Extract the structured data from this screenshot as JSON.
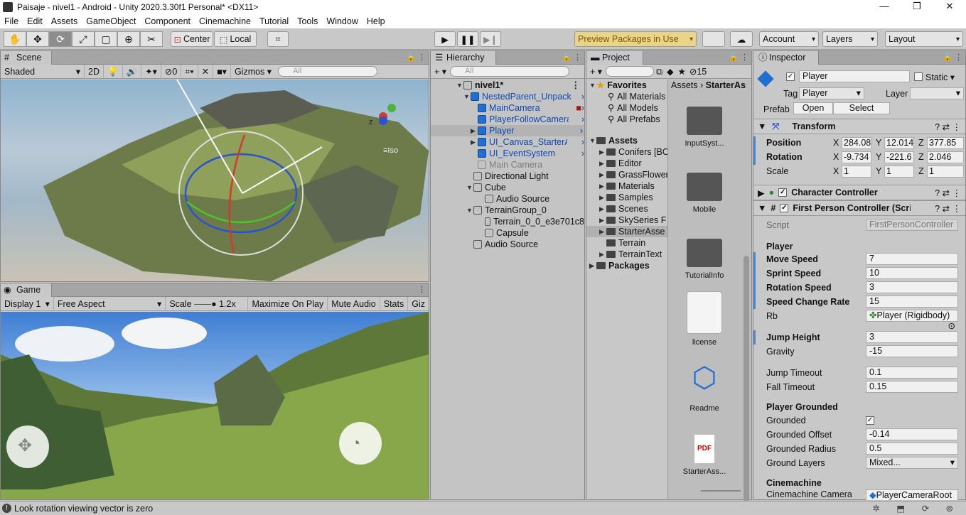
{
  "window": {
    "title": "Paisaje - nivel1 - Android - Unity 2020.3.30f1 Personal* <DX11>",
    "minimize": "—",
    "maximize": "❐",
    "close": "✕"
  },
  "menu": [
    "File",
    "Edit",
    "Assets",
    "GameObject",
    "Component",
    "Cinemachine",
    "Tutorial",
    "Tools",
    "Window",
    "Help"
  ],
  "toolbar": {
    "center": "Center",
    "local": "Local",
    "preview": "Preview Packages in Use",
    "account": "Account",
    "layers": "Layers",
    "layout": "Layout"
  },
  "scene": {
    "tab": "Scene",
    "shading": "Shaded",
    "mode2d": "2D",
    "hidden_count": "0",
    "gizmos": "Gizmos",
    "search_placeholder": "All",
    "persp": "Iso",
    "axis_z": "z"
  },
  "game": {
    "tab": "Game",
    "display": "Display 1",
    "aspect": "Free Aspect",
    "scale_label": "Scale",
    "scale_value": "1.2x",
    "maximize": "Maximize On Play",
    "mute": "Mute Audio",
    "stats": "Stats",
    "gizmos": "Giz"
  },
  "hierarchy": {
    "tab": "Hierarchy",
    "search_placeholder": "All",
    "items": [
      {
        "label": "nivel1*",
        "bold": true
      },
      {
        "label": "NestedParent_Unpack",
        "blue": true
      },
      {
        "label": "MainCamera",
        "blue": true
      },
      {
        "label": "PlayerFollowCamera",
        "blue": true
      },
      {
        "label": "Player",
        "blue": true
      },
      {
        "label": "UI_Canvas_StarterA",
        "blue": true
      },
      {
        "label": "UI_EventSystem",
        "blue": true
      },
      {
        "label": "Main Camera",
        "grey": true
      },
      {
        "label": "Directional Light"
      },
      {
        "label": "Cube"
      },
      {
        "label": "Audio Source"
      },
      {
        "label": "TerrainGroup_0"
      },
      {
        "label": "Terrain_0_0_e3e701c8"
      },
      {
        "label": "Capsule"
      },
      {
        "label": "Audio Source"
      }
    ]
  },
  "project": {
    "tab": "Project",
    "badge": "15",
    "favorites": "Favorites",
    "fav_items": [
      "All Materials",
      "All Models",
      "All Prefabs"
    ],
    "assets": "Assets",
    "asset_items": [
      "Conifers [BO",
      "Editor",
      "GrassFlowers",
      "Materials",
      "Samples",
      "Scenes",
      "SkySeries F",
      "StarterAsse",
      "Terrain",
      "TerrainText"
    ],
    "packages": "Packages",
    "breadcrumb": [
      "Assets",
      "StarterAss"
    ],
    "grid": [
      "InputSyst...",
      "Mobile",
      "TutorialInfo",
      "license",
      "Readme",
      "StarterAss..."
    ],
    "pdf": "PDF"
  },
  "inspector": {
    "tab": "Inspector",
    "name": "Player",
    "static": "Static",
    "tag_label": "Tag",
    "tag": "Player",
    "layer_label": "Layer",
    "prefab_label": "Prefab",
    "open": "Open",
    "select": "Select",
    "transform": {
      "title": "Transform",
      "position": "Position",
      "rotation": "Rotation",
      "scale": "Scale",
      "pos": [
        "284.08",
        "12.014",
        "377.85"
      ],
      "rot": [
        "-9.734",
        "-221.6",
        "2.046"
      ],
      "scl": [
        "1",
        "1",
        "1"
      ],
      "x": "X",
      "y": "Y",
      "z": "Z"
    },
    "character_controller": "Character Controller",
    "fpc": {
      "title": "First Person Controller (Script)",
      "script_label": "Script",
      "script": "FirstPersonController",
      "sec_player": "Player",
      "move_speed": [
        "Move Speed",
        "7"
      ],
      "sprint_speed": [
        "Sprint Speed",
        "10"
      ],
      "rotation_speed": [
        "Rotation Speed",
        "3"
      ],
      "speed_change": [
        "Speed Change Rate",
        "15"
      ],
      "rb": [
        "Rb",
        "Player (Rigidbody)"
      ],
      "jump_height": [
        "Jump Height",
        "3"
      ],
      "gravity": [
        "Gravity",
        "-15"
      ],
      "jump_timeout": [
        "Jump Timeout",
        "0.1"
      ],
      "fall_timeout": [
        "Fall Timeout",
        "0.15"
      ],
      "sec_grounded": "Player Grounded",
      "grounded": "Grounded",
      "grounded_offset": [
        "Grounded Offset",
        "-0.14"
      ],
      "grounded_radius": [
        "Grounded Radius",
        "0.5"
      ],
      "ground_layers": [
        "Ground Layers",
        "Mixed..."
      ],
      "sec_cine": "Cinemachine",
      "cine_target": [
        "Cinemachine Camera",
        "PlayerCameraRoot"
      ]
    }
  },
  "status": {
    "message": "Look rotation viewing vector is zero"
  }
}
